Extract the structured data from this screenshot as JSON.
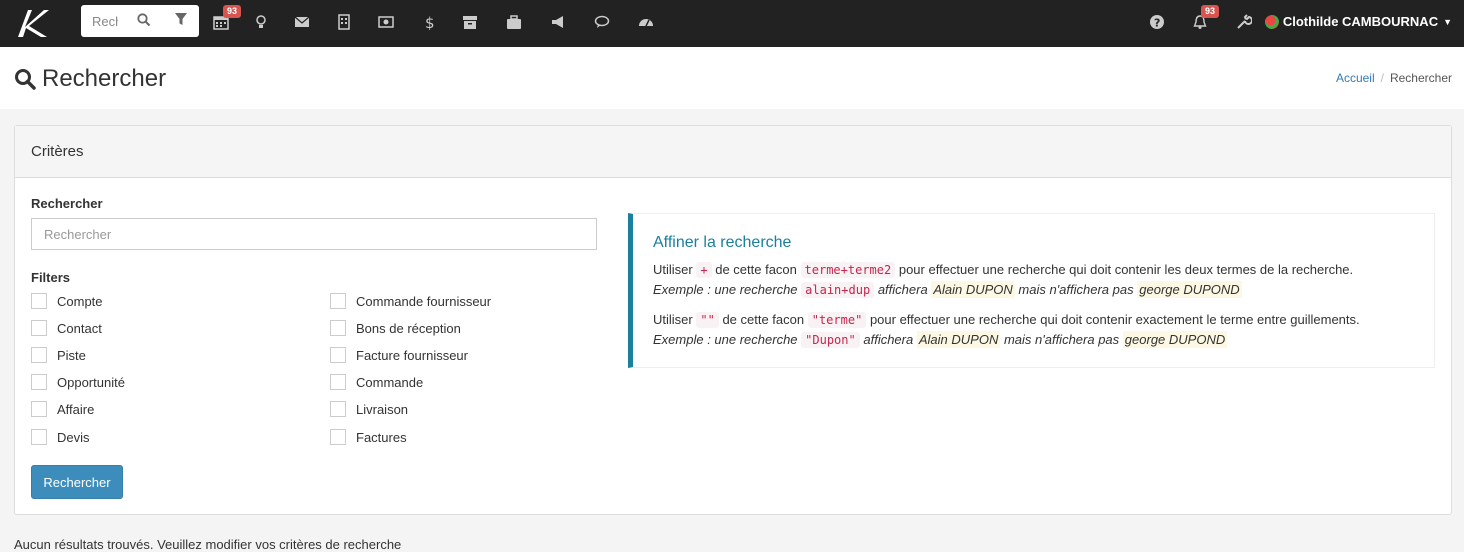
{
  "topbar": {
    "search_text": "Rechercher",
    "calendar_badge": "93",
    "notifications_badge": "93",
    "user_name": "Clothilde CAMBOURNAC",
    "nav_icons": [
      "calendar-icon",
      "lightbulb-icon",
      "envelope-icon",
      "building-icon",
      "money-icon",
      "dollar-icon",
      "archive-icon",
      "briefcase-icon",
      "bullhorn-icon",
      "comments-icon",
      "dashboard-icon"
    ]
  },
  "page": {
    "title": "Rechercher",
    "breadcrumb_home": "Accueil",
    "breadcrumb_current": "Rechercher"
  },
  "panel": {
    "heading": "Critères",
    "search_label": "Rechercher",
    "search_placeholder": "Rechercher",
    "filters_label": "Filters",
    "filters_left": [
      "Compte",
      "Contact",
      "Piste",
      "Opportunité",
      "Affaire",
      "Devis"
    ],
    "filters_right": [
      "Commande fournisseur",
      "Bons de réception",
      "Facture fournisseur",
      "Commande",
      "Livraison",
      "Factures"
    ],
    "submit_label": "Rechercher"
  },
  "help": {
    "title": "Affiner la recherche",
    "l1_a": "Utiliser",
    "l1_code": "+",
    "l1_b": "de cette facon",
    "l1_code2": "terme+terme2",
    "l1_c": "pour effectuer une recherche qui doit contenir les deux termes de la recherche.",
    "l2_a": "Exemple : une recherche",
    "l2_code": "alain+dup",
    "l2_b": "affichera",
    "l2_mark1": "Alain DUPON",
    "l2_c": "mais n'affichera pas",
    "l2_mark2": "george DUPOND",
    "l3_a": "Utiliser",
    "l3_code": "\"\"",
    "l3_b": "de cette facon",
    "l3_code2": "\"terme\"",
    "l3_c": "pour effectuer une recherche qui doit contenir exactement le terme entre guillements.",
    "l4_a": "Exemple : une recherche",
    "l4_code": "\"Dupon\"",
    "l4_b": "affichera",
    "l4_mark1": "Alain DUPON",
    "l4_c": "mais n'affichera pas",
    "l4_mark2": "george DUPOND"
  },
  "results": {
    "message": "Aucun résultats trouvés. Veuillez modifier vos critères de recherche"
  }
}
